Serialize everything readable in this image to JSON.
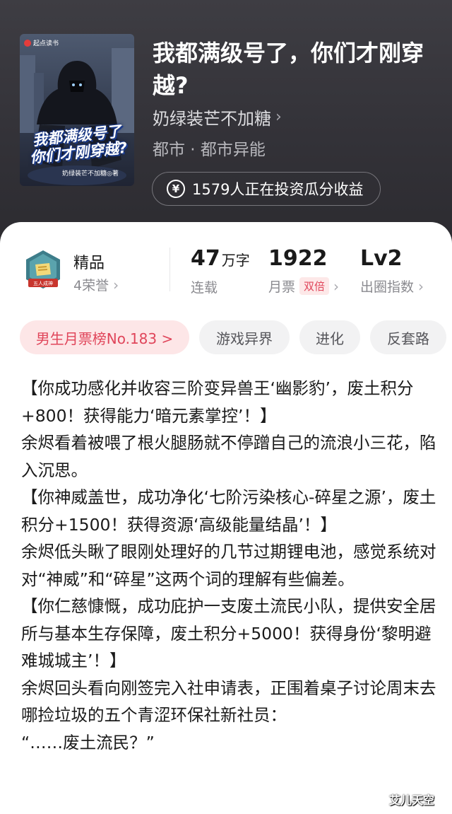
{
  "book": {
    "cover": {
      "brand": "起点读书",
      "title_line1": "我都满级号了",
      "title_line2": "你们才刚穿越?",
      "author_tag": "奶绿装芒不加糖◎著"
    },
    "title": "我都满级号了，你们才刚穿越?",
    "author": "奶绿装芒不加糖",
    "genre": "都市 · 都市异能",
    "invest_text": "1579人正在投资瓜分收益",
    "invest_icon": "yen-icon"
  },
  "stats": {
    "quality_label": "精品",
    "honor": "4荣誉",
    "badge_text": "五人成神",
    "words_num": "47",
    "words_unit": "万字",
    "words_status": "连载",
    "monthly_votes": "1922",
    "monthly_votes_label": "月票",
    "double_tag": "双倍",
    "level": "Lv2",
    "level_label": "出圈指数"
  },
  "tags": [
    {
      "label": "男生月票榜No.183 >"
    },
    {
      "label": "游戏异界"
    },
    {
      "label": "进化"
    },
    {
      "label": "反套路"
    }
  ],
  "content": [
    "【你成功感化并收容三阶变异兽王‘幽影豹’，废土积分+800！获得能力‘暗元素掌控’！】",
    "余烬看着被喂了根火腿肠就不停蹭自己的流浪小三花，陷入沉思。",
    "【你神威盖世，成功净化‘七阶污染核心-碎星之源’，废土积分+1500！获得资源‘高级能量结晶’！】",
    "余烬低头瞅了眼刚处理好的几节过期锂电池，感觉系统对对“神威”和“碎星”这两个词的理解有些偏差。",
    "【你仁慈慷慨，成功庇护一支废土流民小队，提供安全居所与基本生存保障，废土积分+5000！获得身份‘黎明避难城城主’！】",
    "余烬回头看向刚签完入社申请表，正围着桌子讨论周末去哪捡垃圾的五个青涩环保社新社员：",
    "“……废土流民？”"
  ],
  "watermark": "艾儿天空",
  "colors": {
    "header_bg": "#37363b",
    "accent_red": "#e0455a",
    "tag_bg": "#f2f2f3"
  }
}
